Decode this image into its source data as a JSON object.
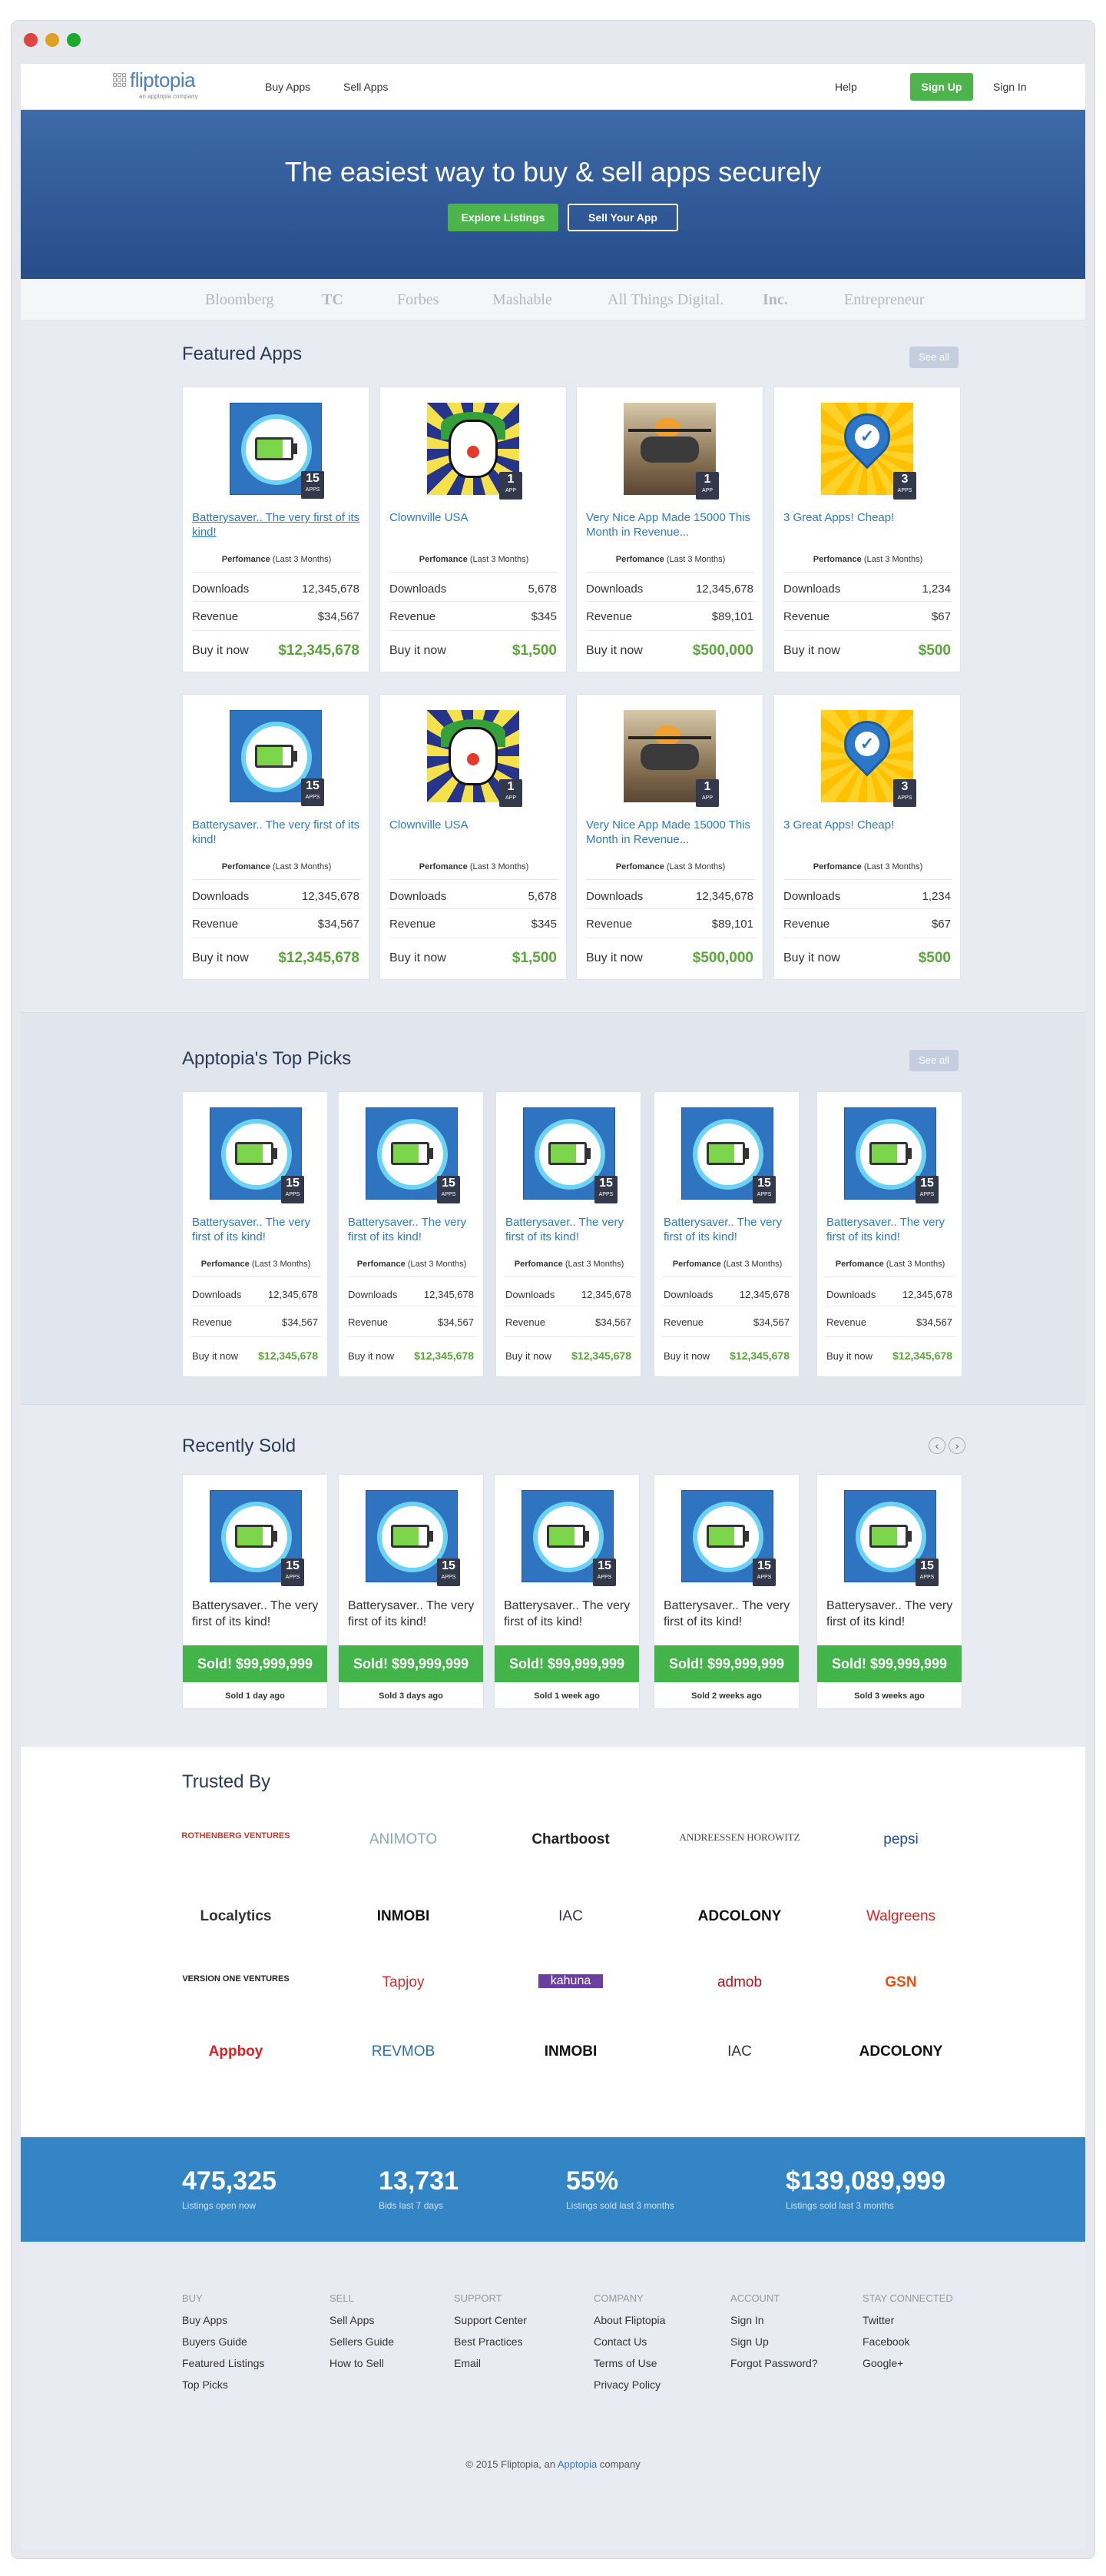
{
  "nav": {
    "logo": "fliptopia",
    "logo_sub": "an apptopia company",
    "buy": "Buy Apps",
    "sell": "Sell Apps",
    "help": "Help",
    "signup": "Sign Up",
    "signin": "Sign In"
  },
  "hero": {
    "title": "The easiest way to buy & sell apps securely",
    "explore": "Explore Listings",
    "sell": "Sell Your App"
  },
  "press": [
    "Bloomberg",
    "TC",
    "Forbes",
    "Mashable",
    "All Things Digital.",
    "Inc.",
    "Entrepreneur"
  ],
  "featured": {
    "title": "Featured Apps",
    "see_all": "See all",
    "cards": [
      {
        "icon": "battery-icon",
        "count": "15",
        "unit": "APPS",
        "title": "Batterysaver.. The very first of its kind!",
        "perf": "Perfomance",
        "perf_sub": "(Last 3 Months)",
        "dl_label": "Downloads",
        "dl": "12,345,678",
        "rev_label": "Revenue",
        "rev": "$34,567",
        "buy": "Buy it now",
        "price": "$12,345,678"
      },
      {
        "icon": "clown-icon",
        "count": "1",
        "unit": "APP",
        "title": "Clownville USA",
        "perf": "Perfomance",
        "perf_sub": "(Last 3 Months)",
        "dl_label": "Downloads",
        "dl": "5,678",
        "rev_label": "Revenue",
        "rev": "$345",
        "buy": "Buy it now",
        "price": "$1,500"
      },
      {
        "icon": "helicopter-icon",
        "count": "1",
        "unit": "APP",
        "title": "Very Nice App Made 15000 This Month in Revenue...",
        "perf": "Perfomance",
        "perf_sub": "(Last 3 Months)",
        "dl_label": "Downloads",
        "dl": "12,345,678",
        "rev_label": "Revenue",
        "rev": "$89,101",
        "buy": "Buy it now",
        "price": "$500,000"
      },
      {
        "icon": "map-pin-icon",
        "count": "3",
        "unit": "APPS",
        "title": "3 Great Apps! Cheap!",
        "perf": "Perfomance",
        "perf_sub": "(Last 3 Months)",
        "dl_label": "Downloads",
        "dl": "1,234",
        "rev_label": "Revenue",
        "rev": "$67",
        "buy": "Buy it now",
        "price": "$500"
      }
    ]
  },
  "top_picks": {
    "title": "Apptopia's Top Picks",
    "see_all": "See all",
    "card": {
      "count": "15",
      "unit": "APPS",
      "title": "Batterysaver.. The very first of its kind!",
      "perf": "Perfomance",
      "perf_sub": "(Last 3 Months)",
      "dl_label": "Downloads",
      "dl": "12,345,678",
      "rev_label": "Revenue",
      "rev": "$34,567",
      "buy": "Buy it now",
      "price": "$12,345,678"
    }
  },
  "recently_sold": {
    "title": "Recently Sold",
    "prev": "‹",
    "next": "›",
    "items": [
      {
        "count": "15",
        "unit": "APPS",
        "title": "Batterysaver.. The very first of its kind!",
        "sold": "Sold!  $99,999,999",
        "ago": "Sold 1 day ago"
      },
      {
        "count": "15",
        "unit": "APPS",
        "title": "Batterysaver.. The very first of its kind!",
        "sold": "Sold!  $99,999,999",
        "ago": "Sold 3 days ago"
      },
      {
        "count": "15",
        "unit": "APPS",
        "title": "Batterysaver.. The very first of its kind!",
        "sold": "Sold!  $99,999,999",
        "ago": "Sold 1 week ago"
      },
      {
        "count": "15",
        "unit": "APPS",
        "title": "Batterysaver.. The very first of its kind!",
        "sold": "Sold!  $99,999,999",
        "ago": "Sold 2 weeks ago"
      },
      {
        "count": "15",
        "unit": "APPS",
        "title": "Batterysaver.. The very first of its kind!",
        "sold": "Sold!  $99,999,999",
        "ago": "Sold 3 weeks ago"
      }
    ]
  },
  "trusted": {
    "title": "Trusted By",
    "logos": [
      "ROTHENBERG VENTURES",
      "ANIMOTO",
      "Chartboost",
      "ANDREESSEN HOROWITZ",
      "pepsi",
      "Localytics",
      "INMOBI",
      "IAC",
      "ADCOLONY",
      "Walgreens",
      "VERSION ONE VENTURES",
      "Tapjoy",
      "kahuna",
      "admob",
      "GSN",
      "Appboy",
      "REVMOB",
      "INMOBI",
      "IAC",
      "ADCOLONY"
    ]
  },
  "stats": [
    {
      "n": "475,325",
      "l": "Listings open now"
    },
    {
      "n": "13,731",
      "l": "Bids last 7 days"
    },
    {
      "n": "55%",
      "l": "Listings sold last 3 months"
    },
    {
      "n": "$139,089,999",
      "l": "Listings sold last 3 months"
    }
  ],
  "footer": {
    "cols": [
      {
        "h": "BUY",
        "links": [
          "Buy Apps",
          "Buyers Guide",
          "Featured Listings",
          "Top Picks"
        ]
      },
      {
        "h": "SELL",
        "links": [
          "Sell Apps",
          "Sellers Guide",
          "How to Sell"
        ]
      },
      {
        "h": "SUPPORT",
        "links": [
          "Support Center",
          "Best Practices",
          "Email"
        ]
      },
      {
        "h": "COMPANY",
        "links": [
          "About Fliptopia",
          "Contact Us",
          "Terms of Use",
          "Privacy Policy"
        ]
      },
      {
        "h": "ACCOUNT",
        "links": [
          "Sign In",
          "Sign Up",
          "Forgot Password?"
        ]
      },
      {
        "h": "STAY CONNECTED",
        "links": [
          "Twitter",
          "Facebook",
          "Google+"
        ]
      }
    ],
    "copy": "© 2015 Fliptopia,",
    "copy_an": "an",
    "copy_link": "Apptopia",
    "copy_end": "company"
  },
  "colors": {
    "green": "#4cb44a",
    "blue": "#3485c6",
    "link": "#2d7ac0",
    "navy": "#2b3a55"
  }
}
